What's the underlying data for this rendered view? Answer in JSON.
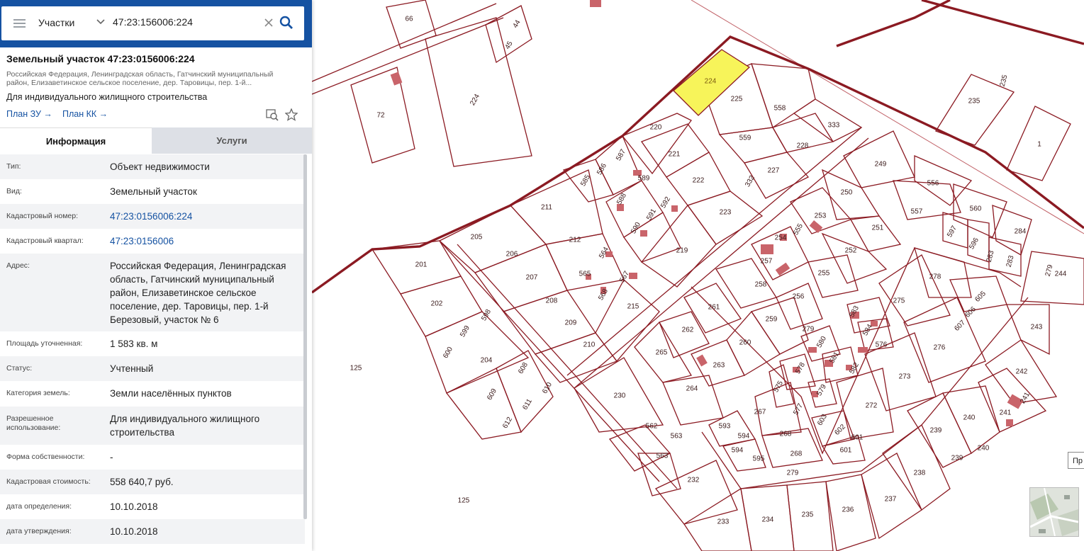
{
  "search": {
    "type_label": "Участки",
    "query": "47:23:156006:224"
  },
  "card": {
    "title": "Земельный участок 47:23:0156006:224",
    "address": "Российская Федерация, Ленинградская область, Гатчинский муниципальный район, Елизаветинское сельское поселение, дер. Таровицы, пер. 1-й...",
    "purpose": "Для индивидуального жилищного строительства",
    "link_plan_zu": "План ЗУ →",
    "link_plan_kk": "План КК →"
  },
  "tabs": {
    "info": "Информация",
    "services": "Услуги"
  },
  "info_rows": [
    {
      "key": "Тип:",
      "value": "Объект недвижимости"
    },
    {
      "key": "Вид:",
      "value": "Земельный участок"
    },
    {
      "key": "Кадастровый номер:",
      "value": "47:23:0156006:224"
    },
    {
      "key": "Кадастровый квартал:",
      "value": "47:23:0156006"
    },
    {
      "key": "Адрес:",
      "value": "Российская Федерация, Ленинградская область, Гатчинский муниципальный район, Елизаветинское сельское поселение, дер. Таровицы, пер. 1-й Березовый, участок № 6"
    },
    {
      "key": "Площадь уточненная:",
      "value": "1 583 кв. м"
    },
    {
      "key": "Статус:",
      "value": "Учтенный"
    },
    {
      "key": "Категория земель:",
      "value": "Земли населённых пунктов"
    },
    {
      "key": "Разрешенное использование:",
      "value": "Для индивидуального жилищного строительства"
    },
    {
      "key": "Форма собственности:",
      "value": "-"
    },
    {
      "key": "Кадастровая стоимость:",
      "value": "558 640,7 руб."
    },
    {
      "key": "дата определения:",
      "value": "10.10.2018"
    },
    {
      "key": "дата утверждения:",
      "value": "10.10.2018"
    }
  ],
  "map": {
    "selected_plot": "224",
    "plot_labels": [
      "66",
      "44",
      "45",
      "72",
      "224",
      "125",
      "201",
      "202",
      "600",
      "599",
      "598",
      "204",
      "609",
      "608",
      "612",
      "611",
      "610",
      "205",
      "206",
      "207",
      "208",
      "209",
      "210",
      "211",
      "212",
      "564",
      "565",
      "567",
      "568",
      "215",
      "585",
      "586",
      "587",
      "588",
      "589",
      "590",
      "591",
      "592",
      "220",
      "221",
      "222",
      "223",
      "219",
      "225",
      "558",
      "559",
      "333",
      "228",
      "227",
      "332",
      "249",
      "250",
      "253",
      "254",
      "555",
      "251",
      "252",
      "257",
      "255",
      "258",
      "256",
      "261",
      "262",
      "265",
      "263",
      "260",
      "259",
      "264",
      "230",
      "562",
      "563",
      "232",
      "233",
      "234",
      "235",
      "236",
      "237",
      "238",
      "239",
      "240",
      "241",
      "242",
      "243",
      "244",
      "276",
      "273",
      "272",
      "275",
      "278",
      "279",
      "605",
      "606",
      "607",
      "583",
      "584",
      "576",
      "580",
      "578",
      "581",
      "582",
      "575",
      "579",
      "577",
      "267",
      "603",
      "602",
      "601",
      "593",
      "594",
      "595",
      "268",
      "556",
      "557",
      "597",
      "596",
      "560",
      "284",
      "283",
      "1"
    ],
    "tooltip": "Пр",
    "colors": {
      "selected_fill": "#f7f45a",
      "plot_stroke": "#8b1a22",
      "building": "#c9646a",
      "header": "#1552a2"
    }
  }
}
